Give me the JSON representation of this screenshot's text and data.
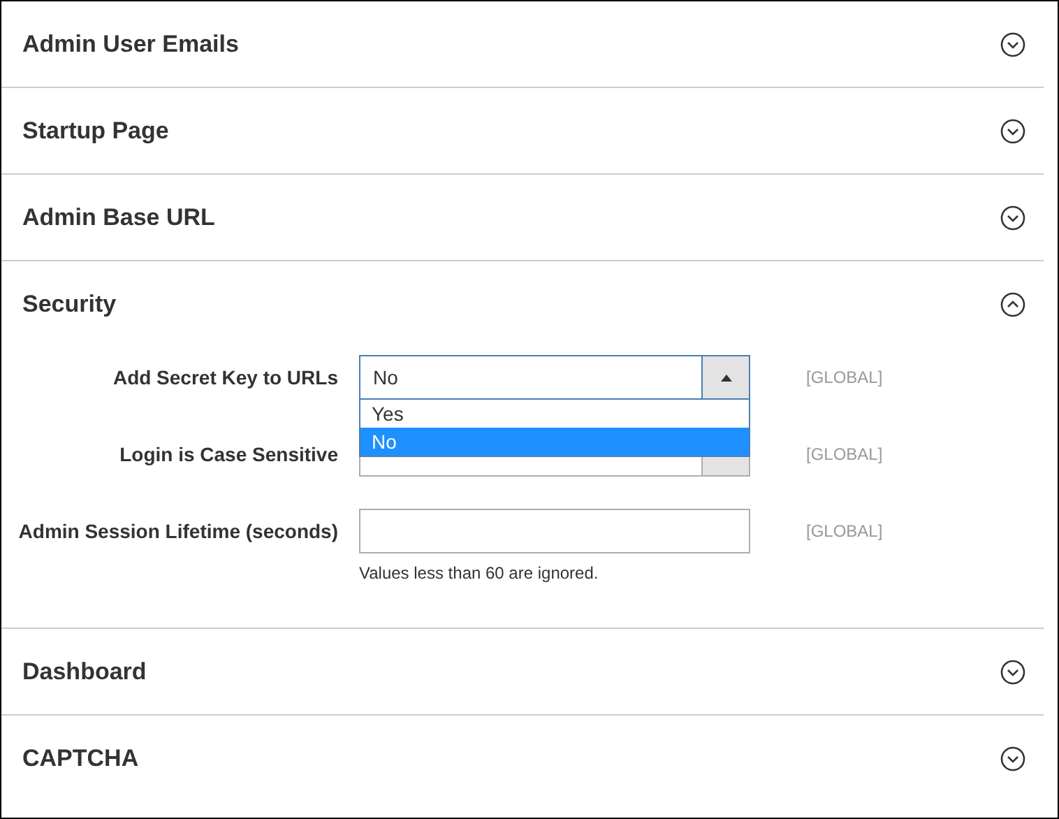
{
  "sections": [
    {
      "title": "Admin User Emails",
      "expanded": false
    },
    {
      "title": "Startup Page",
      "expanded": false
    },
    {
      "title": "Admin Base URL",
      "expanded": false
    },
    {
      "title": "Security",
      "expanded": true,
      "fields": [
        {
          "kind": "select",
          "label": "Add Secret Key to URLs",
          "value": "No",
          "scope": "[GLOBAL]",
          "expanded": true,
          "options": [
            {
              "label": "Yes",
              "selected": false
            },
            {
              "label": "No",
              "selected": true
            }
          ]
        },
        {
          "kind": "select",
          "label": "Login is Case Sensitive",
          "scope": "[GLOBAL]",
          "expanded": false
        },
        {
          "kind": "text",
          "label": "Admin Session Lifetime (seconds)",
          "scope": "[GLOBAL]",
          "note": "Values less than 60 are ignored."
        }
      ]
    },
    {
      "title": "Dashboard",
      "expanded": false
    },
    {
      "title": "CAPTCHA",
      "expanded": false
    }
  ]
}
